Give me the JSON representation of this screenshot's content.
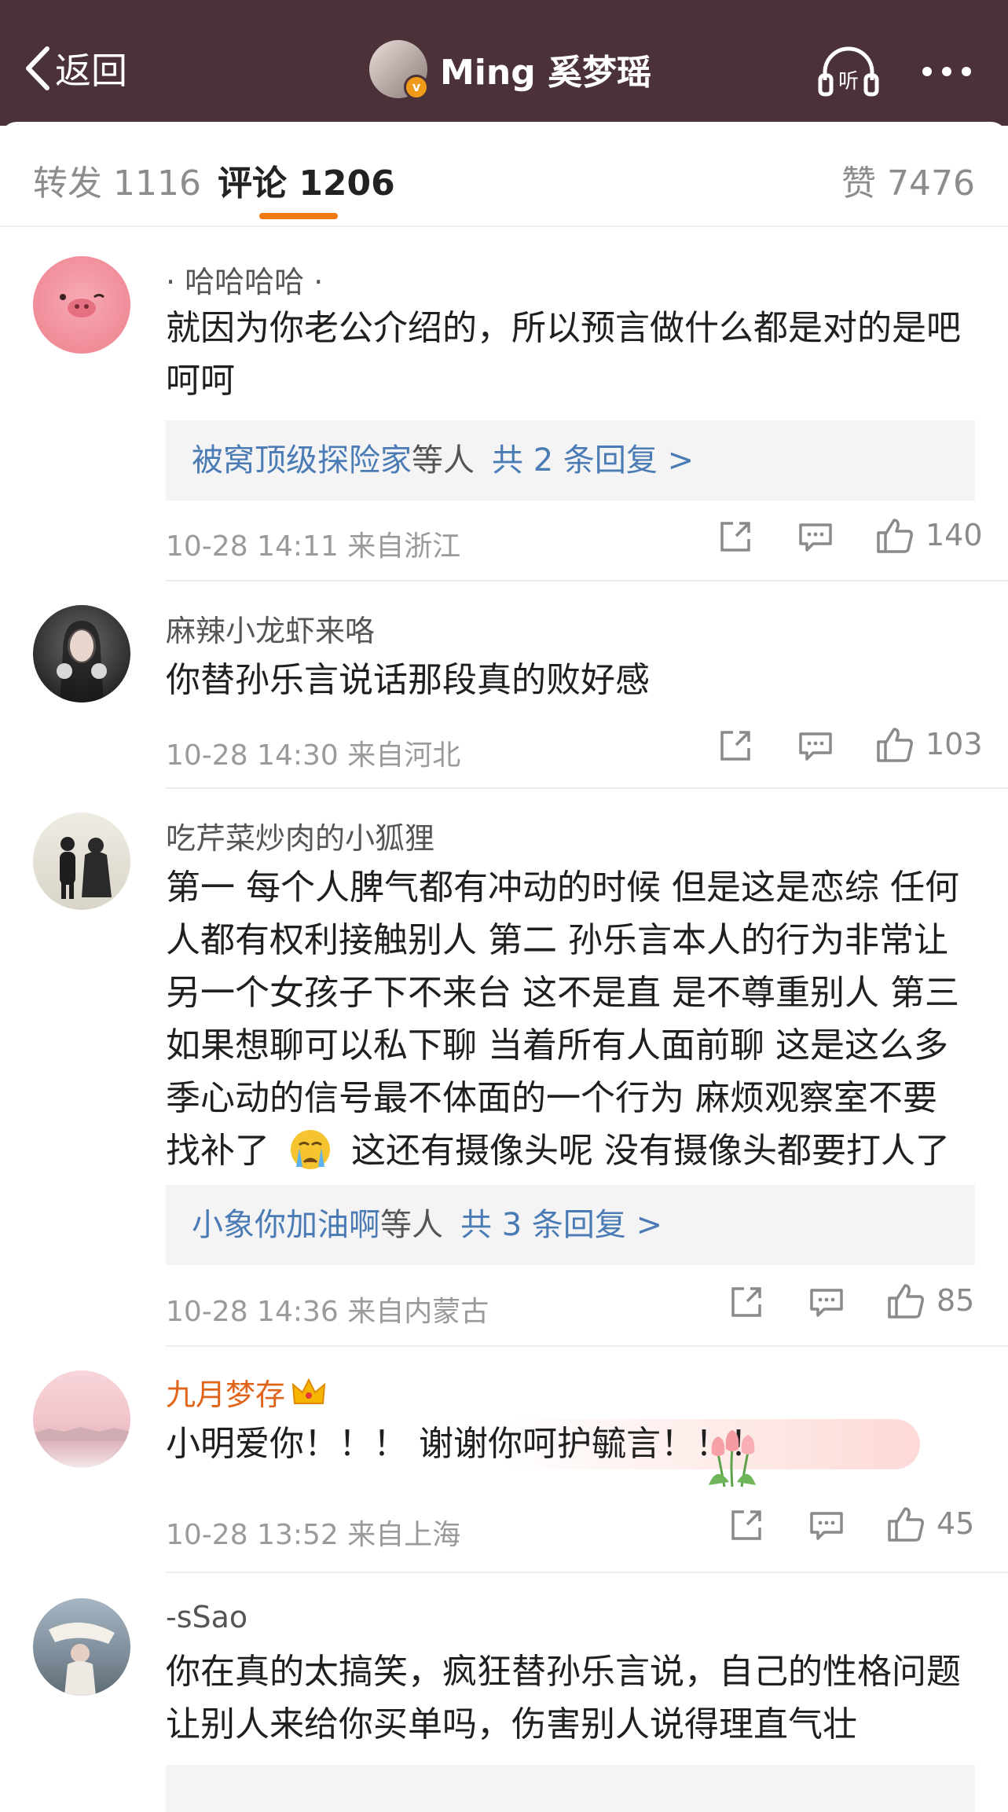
{
  "header": {
    "back_label": "返回",
    "title": "Ming 奚梦瑶",
    "listen_label": "听"
  },
  "tabs": [
    {
      "label": "转发 1116"
    },
    {
      "label": "评论 1206"
    },
    {
      "label": "赞 7476"
    }
  ],
  "comments": [
    {
      "user": "· 哈哈哈哈 ·",
      "text": [
        "就因为你老公介绍的，所以预言做什么都是对的是吧",
        "呵呵"
      ],
      "reply": {
        "names": "被窝顶级探险家",
        "middle": "等人",
        "count": "共 2 条回复 >"
      },
      "time": "10-28 14:11 来自浙江",
      "likes": "140"
    },
    {
      "user": "麻辣小龙虾来咯",
      "text": [
        "你替孙乐言说话那段真的败好感"
      ],
      "time": "10-28 14:30 来自河北",
      "likes": "103"
    },
    {
      "user": "吃芹菜炒肉的小狐狸",
      "text": [
        "第一 每个人脾气都有冲动的时候 但是这是恋综 任何",
        "人都有权利接触别人  第二 孙乐言本人的行为非常让",
        "另一个女孩子下不来台 这不是直 是不尊重别人 第三",
        "如果想聊可以私下聊 当着所有人面前聊 这是这么多",
        "季心动的信号最不体面的一个行为 麻烦观察室不要",
        "找补了",
        "这还有摄像头呢 没有摄像头都要打人了"
      ],
      "reply": {
        "names": "小象你加油啊",
        "middle": "等人",
        "count": "共 3 条回复 >"
      },
      "time": "10-28 14:36 来自内蒙古",
      "likes": "85"
    },
    {
      "user": "九月梦存",
      "text": [
        "小明爱你！！！ 谢谢你呵护毓言！！！"
      ],
      "time": "10-28 13:52 来自上海",
      "likes": "45"
    },
    {
      "user": "-sSao",
      "text": [
        "你在真的太搞笑，疯狂替孙乐言说，自己的性格问题",
        "让别人来给你买单吗，伤害别人说得理直气壮"
      ]
    }
  ],
  "icons": {
    "back": "chevron-left-icon",
    "listen": "headphones-icon",
    "more": "more-dots-icon",
    "share": "share-icon",
    "comment": "comment-icon",
    "like": "thumbs-up-icon",
    "crown": "crown-icon",
    "crying": "crying-emoji-icon",
    "tulip": "tulip-icon"
  },
  "colors": {
    "header_bg": "#4a3238",
    "accent": "#f07a10",
    "link": "#4a7bb5",
    "vip_name": "#e0651a"
  }
}
